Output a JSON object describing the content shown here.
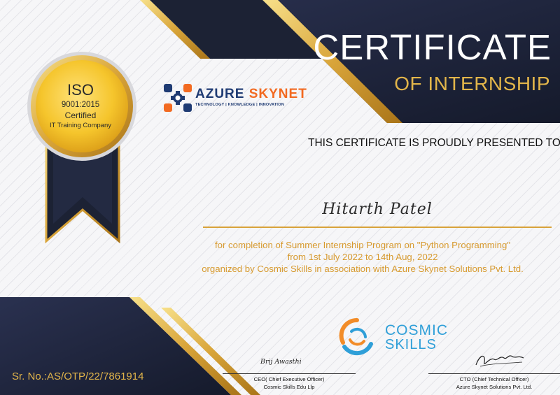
{
  "certificate": {
    "title": "CERTIFICATE",
    "subtitle": "OF INTERNSHIP",
    "presented_text": "THIS CERTIFICATE IS PROUDLY PRESENTED TO",
    "recipient_name": "Hitarth Patel",
    "body_lines": [
      "for completion of Summer Internship Program on \"Python Programming\"",
      "from 1st July 2022 to 14th Aug, 2022",
      "organized by Cosmic Skills in association with Azure Skynet Solutions Pvt. Ltd."
    ],
    "serial_number": "Sr. No.:AS/OTP/22/7861914"
  },
  "seal": {
    "line1": "ISO",
    "line2": "9001:2015",
    "line3": "Certified",
    "line4": "IT Training Company"
  },
  "azure_logo": {
    "name_part1": "AZURE",
    "name_part2": "SKYNET",
    "tagline": "TECHNOLOGY | KNOWLEDGE | INNOVATION"
  },
  "cosmic_logo": {
    "line1": "COSMIC",
    "line2": "SKILLS"
  },
  "signatories": [
    {
      "signature": "Brij Awasthi",
      "title": "CEO( Chief Executive Officer)",
      "organization": "Cosmic Skills Edu Llp"
    },
    {
      "title": "CTO (Chief Technical Officer)",
      "organization": "Azure Skynet Solutions Pvt. Ltd."
    }
  ],
  "colors": {
    "navy": "#1e2438",
    "gold": "#e2b54a",
    "body_text": "#d79a2f",
    "azure_blue": "#1f3b73",
    "azure_orange": "#f26a21",
    "cosmic_blue": "#2f9fd8"
  }
}
